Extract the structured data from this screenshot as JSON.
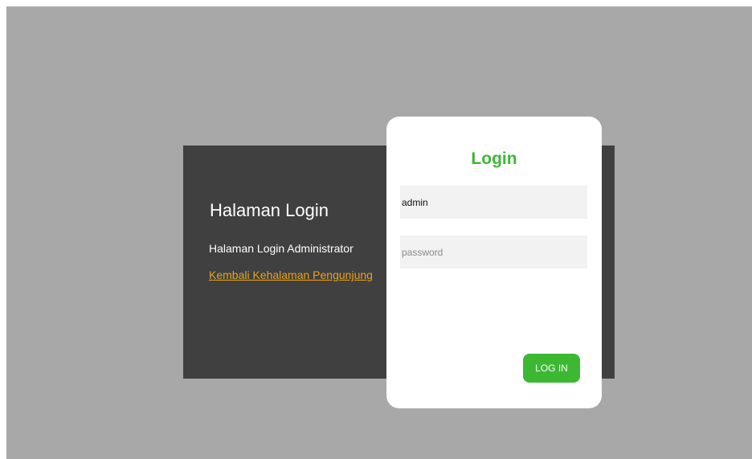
{
  "intro": {
    "title": "Halaman Login",
    "subtitle": "Halaman Login Administrator",
    "back_link": "Kembali Kehalaman Pengunjung"
  },
  "login_form": {
    "heading": "Login",
    "username": {
      "value": "admin",
      "placeholder": ""
    },
    "password": {
      "value": "",
      "placeholder": "password"
    },
    "submit_label": "LOG IN"
  },
  "colors": {
    "page_background": "#a8a8a8",
    "panel_background": "#404040",
    "accent_green": "#3cb833",
    "link_orange": "#e8a317",
    "input_background": "#f2f2f2"
  }
}
